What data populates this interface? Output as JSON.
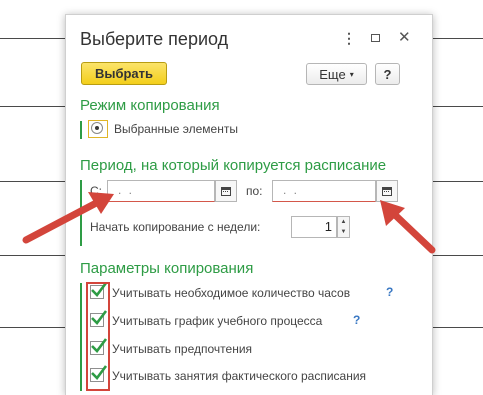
{
  "dialog": {
    "title": "Выберите период",
    "menu_glyph": "⋮",
    "close_glyph": "✕"
  },
  "toolbar": {
    "select_label": "Выбрать",
    "more_label": "Еще",
    "more_caret": "▾",
    "help_label": "?"
  },
  "copy_mode": {
    "title": "Режим копирования",
    "option_label": "Выбранные элементы"
  },
  "period": {
    "title": "Период, на который копируется расписание",
    "from_label": "С:",
    "to_label": "по:",
    "date_mask": ". .",
    "start_week_label": "Начать копирование с недели:",
    "start_week_value": "1",
    "spin_up": "▲",
    "spin_down": "▼"
  },
  "params": {
    "title": "Параметры копирования",
    "help_glyph": "?",
    "items": [
      {
        "label": "Учитывать необходимое количество часов",
        "checked": true
      },
      {
        "label": "Учитывать график учебного процесса",
        "checked": true
      },
      {
        "label": "Учитывать предпочтения",
        "checked": true
      },
      {
        "label": "Учитывать занятия фактического расписания",
        "checked": true
      }
    ]
  },
  "colors": {
    "accent_green": "#2e9c45",
    "annotation_red": "#d3453b",
    "primary_button": "#f3cf1b",
    "help_blue": "#3a78c3"
  }
}
